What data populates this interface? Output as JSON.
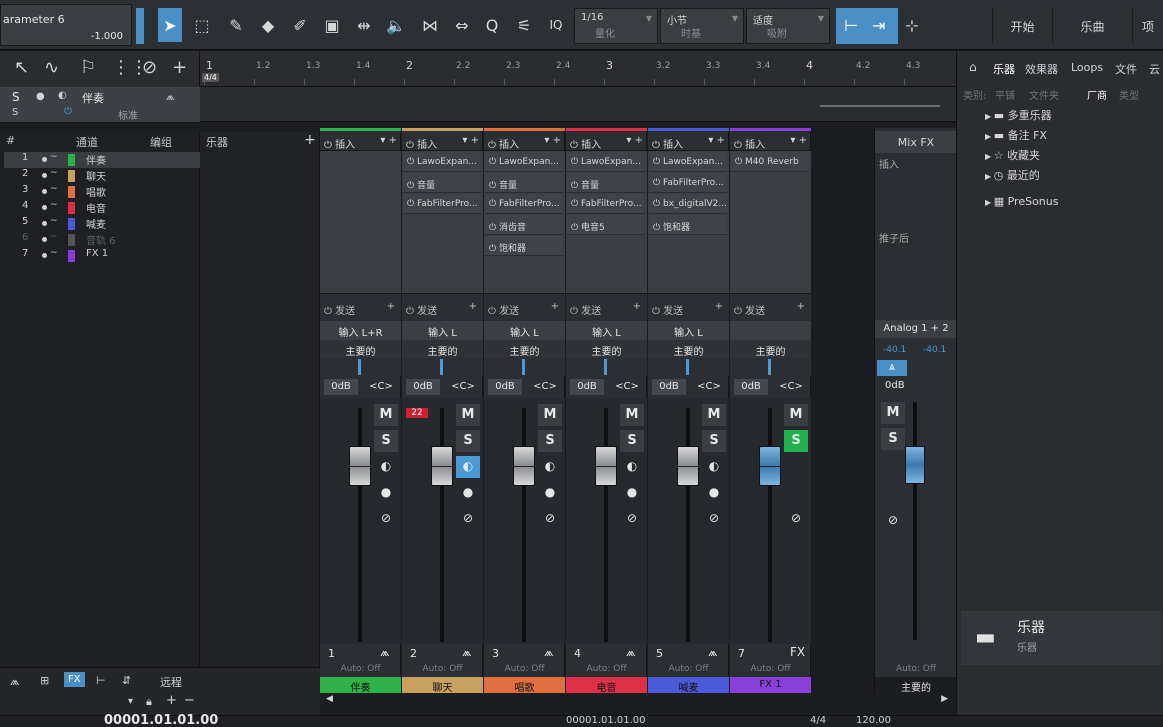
{
  "toolbar": {
    "param_title": "arameter 6",
    "param_value": "-1.000",
    "quantize": {
      "value": "1/16",
      "label": "量化"
    },
    "timebase": {
      "value": "小节",
      "label": "时基"
    },
    "snap": {
      "value": "适度",
      "label": "吸附"
    },
    "iq_label": "IQ",
    "start_button": "开始",
    "song_button": "乐曲",
    "project_button": "项"
  },
  "ruler": {
    "time_sig": "4/4",
    "labels": [
      "1",
      "1.2",
      "1.3",
      "1.4",
      "2",
      "2.2",
      "2.3",
      "2.4",
      "3",
      "3.2",
      "3.3",
      "3.4",
      "4",
      "4.2",
      "4.3"
    ]
  },
  "track_strip": {
    "s": "S",
    "track_name": "伴奏",
    "standard": "标准"
  },
  "channel_list": {
    "headers": {
      "num": "#",
      "channel": "通道",
      "group": "编组",
      "instruments": "乐器"
    },
    "rows": [
      {
        "num": "1",
        "name": "伴奏",
        "color": "#2fb24a",
        "selected": true,
        "dim": false
      },
      {
        "num": "2",
        "name": "聊天",
        "color": "#c8a060",
        "selected": false,
        "dim": false
      },
      {
        "num": "3",
        "name": "唱歌",
        "color": "#e07040",
        "selected": false,
        "dim": false
      },
      {
        "num": "4",
        "name": "电音",
        "color": "#e03048",
        "selected": false,
        "dim": false
      },
      {
        "num": "5",
        "name": "喊麦",
        "color": "#4a5ad8",
        "selected": false,
        "dim": false
      },
      {
        "num": "6",
        "name": "音轨 6",
        "color": "#555555",
        "selected": false,
        "dim": true
      },
      {
        "num": "7",
        "name": "FX 1",
        "color": "#8a40d8",
        "selected": false,
        "dim": false
      }
    ]
  },
  "mixer": {
    "insert_label": "插入",
    "send_label": "发送",
    "auto_label": "Auto: Off",
    "strips": [
      {
        "num": "1",
        "name": "伴奏",
        "color": "#2fb24a",
        "input": "输入 L+R",
        "output": "主要的",
        "plugins": [],
        "db": "0dB",
        "cc": "<C>",
        "s_active": false,
        "i_active": false
      },
      {
        "num": "2",
        "name": "聊天",
        "color": "#c8a060",
        "input": "输入 L",
        "output": "主要的",
        "plugins": [
          "LawoExpan...",
          "音量",
          "FabFilterPro..."
        ],
        "db": "0dB",
        "cc": "<C>",
        "s_active": false,
        "i_active": true,
        "clip": "22"
      },
      {
        "num": "3",
        "name": "唱歌",
        "color": "#e07040",
        "input": "输入 L",
        "output": "主要的",
        "plugins": [
          "LawoExpan...",
          "音量",
          "FabFilterPro...",
          "消齿音",
          "饱和器"
        ],
        "db": "0dB",
        "cc": "<C>",
        "s_active": false,
        "i_active": false
      },
      {
        "num": "4",
        "name": "电音",
        "color": "#e03048",
        "input": "输入 L",
        "output": "主要的",
        "plugins": [
          "LawoExpan...",
          "音量",
          "FabFilterPro...",
          "电音5"
        ],
        "db": "0dB",
        "cc": "<C>",
        "s_active": false,
        "i_active": false
      },
      {
        "num": "5",
        "name": "喊麦",
        "color": "#4a5ad8",
        "input": "输入 L",
        "output": "主要的",
        "plugins": [
          "LawoExpan...",
          "FabFilterPro...",
          "bx_digitalV2...",
          "饱和器"
        ],
        "db": "0dB",
        "cc": "<C>",
        "s_active": false,
        "i_active": false
      },
      {
        "num": "7",
        "name": "FX 1",
        "color": "#8a40d8",
        "input": "",
        "output": "主要的",
        "plugins": [
          "M40 Reverb"
        ],
        "db": "0dB",
        "cc": "<C>",
        "s_active": true,
        "i_active": false,
        "fx": "FX"
      }
    ],
    "master": {
      "mixfx": "Mix FX",
      "insert": "插入",
      "post": "推子后",
      "input": "Analog 1 + 2",
      "levels": [
        "-40.1",
        "-40.1"
      ],
      "db": "0dB",
      "name": "主要的"
    }
  },
  "browser": {
    "tabs": [
      "乐器",
      "效果器",
      "Loops",
      "文件",
      "云"
    ],
    "subtabs": [
      "类别:",
      "平铺",
      "文件夹",
      "厂商",
      "类型"
    ],
    "items": [
      "多重乐器",
      "备注 FX",
      "收藏夹",
      "最近的",
      "PreSonus"
    ],
    "footer_title": "乐器",
    "footer_sub": "乐器"
  },
  "bottom_left": {
    "remote": "远程",
    "fx": "FX"
  },
  "transport": {
    "time": "00001.01.01.00",
    "time2": "00001.01.01.00",
    "sig": "4/4",
    "tempo": "120.00"
  }
}
